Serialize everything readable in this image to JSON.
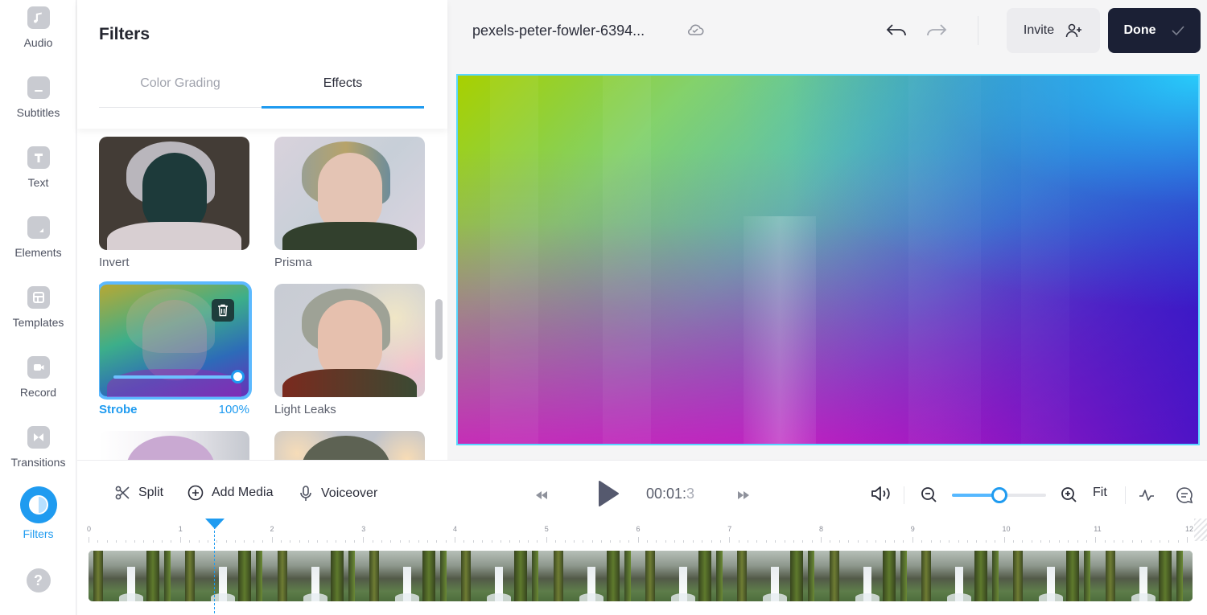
{
  "sidebar": {
    "items": [
      {
        "label": "Audio",
        "icon": "music-note-icon",
        "active": false
      },
      {
        "label": "Subtitles",
        "icon": "subtitles-icon",
        "active": false
      },
      {
        "label": "Text",
        "icon": "text-icon",
        "active": false
      },
      {
        "label": "Elements",
        "icon": "sticker-icon",
        "active": false
      },
      {
        "label": "Templates",
        "icon": "layout-icon",
        "active": false
      },
      {
        "label": "Record",
        "icon": "video-camera-icon",
        "active": false
      },
      {
        "label": "Transitions",
        "icon": "bowtie-icon",
        "active": false
      },
      {
        "label": "Filters",
        "icon": "half-circle-icon",
        "active": true
      }
    ],
    "help_icon": "question-icon",
    "help_glyph": "?"
  },
  "panel": {
    "title": "Filters",
    "tabs": [
      {
        "label": "Color Grading",
        "active": false
      },
      {
        "label": "Effects",
        "active": true
      }
    ],
    "filters": [
      {
        "name": "Invert",
        "selected": false
      },
      {
        "name": "Prisma",
        "selected": false
      },
      {
        "name": "Strobe",
        "selected": true,
        "intensity_label": "100%",
        "intensity": 1.0
      },
      {
        "name": "Light Leaks",
        "selected": false
      }
    ]
  },
  "topbar": {
    "filename": "pexels-peter-fowler-6394...",
    "sync_icon": "cloud-check-icon",
    "invite_label": "Invite",
    "done_label": "Done"
  },
  "accent": "#1f9bf0",
  "timeline": {
    "split_label": "Split",
    "add_media_label": "Add Media",
    "voiceover_label": "Voiceover",
    "time_main": "00:01:",
    "time_frac": "3",
    "fit_label": "Fit",
    "zoom_level": 0.5,
    "playhead_seconds": 1.37,
    "ruler_labels": [
      "0",
      "1",
      "2",
      "3",
      "4",
      "5",
      "6",
      "7",
      "8",
      "9",
      "10",
      "11",
      "12"
    ]
  }
}
